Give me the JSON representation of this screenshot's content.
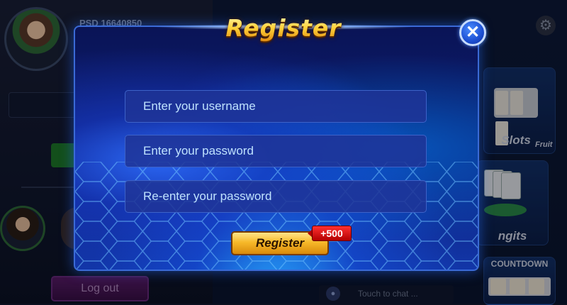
{
  "lobby": {
    "player_id": "PSD 16640850",
    "logout_label": "Log out",
    "chat_placeholder": "Touch to chat ...",
    "games": {
      "slots_title": "Slots",
      "slots_sub": "Fruit",
      "rungits_title": "ngits",
      "countdown_title": "COUNTDOWN"
    }
  },
  "modal": {
    "title": "Register",
    "close_symbol": "✕",
    "fields": {
      "username_placeholder": "Enter your username",
      "password_placeholder": "Enter your password",
      "confirm_placeholder": "Re-enter your password"
    },
    "register_button": "Register",
    "bonus": "+500"
  },
  "colors": {
    "accent": "#3a6ad6",
    "button_gold": "#f7b929",
    "bonus_red": "#d00000"
  },
  "icons": {
    "close": "close-icon",
    "settings": "gear-icon",
    "chat": "chat-icon"
  }
}
